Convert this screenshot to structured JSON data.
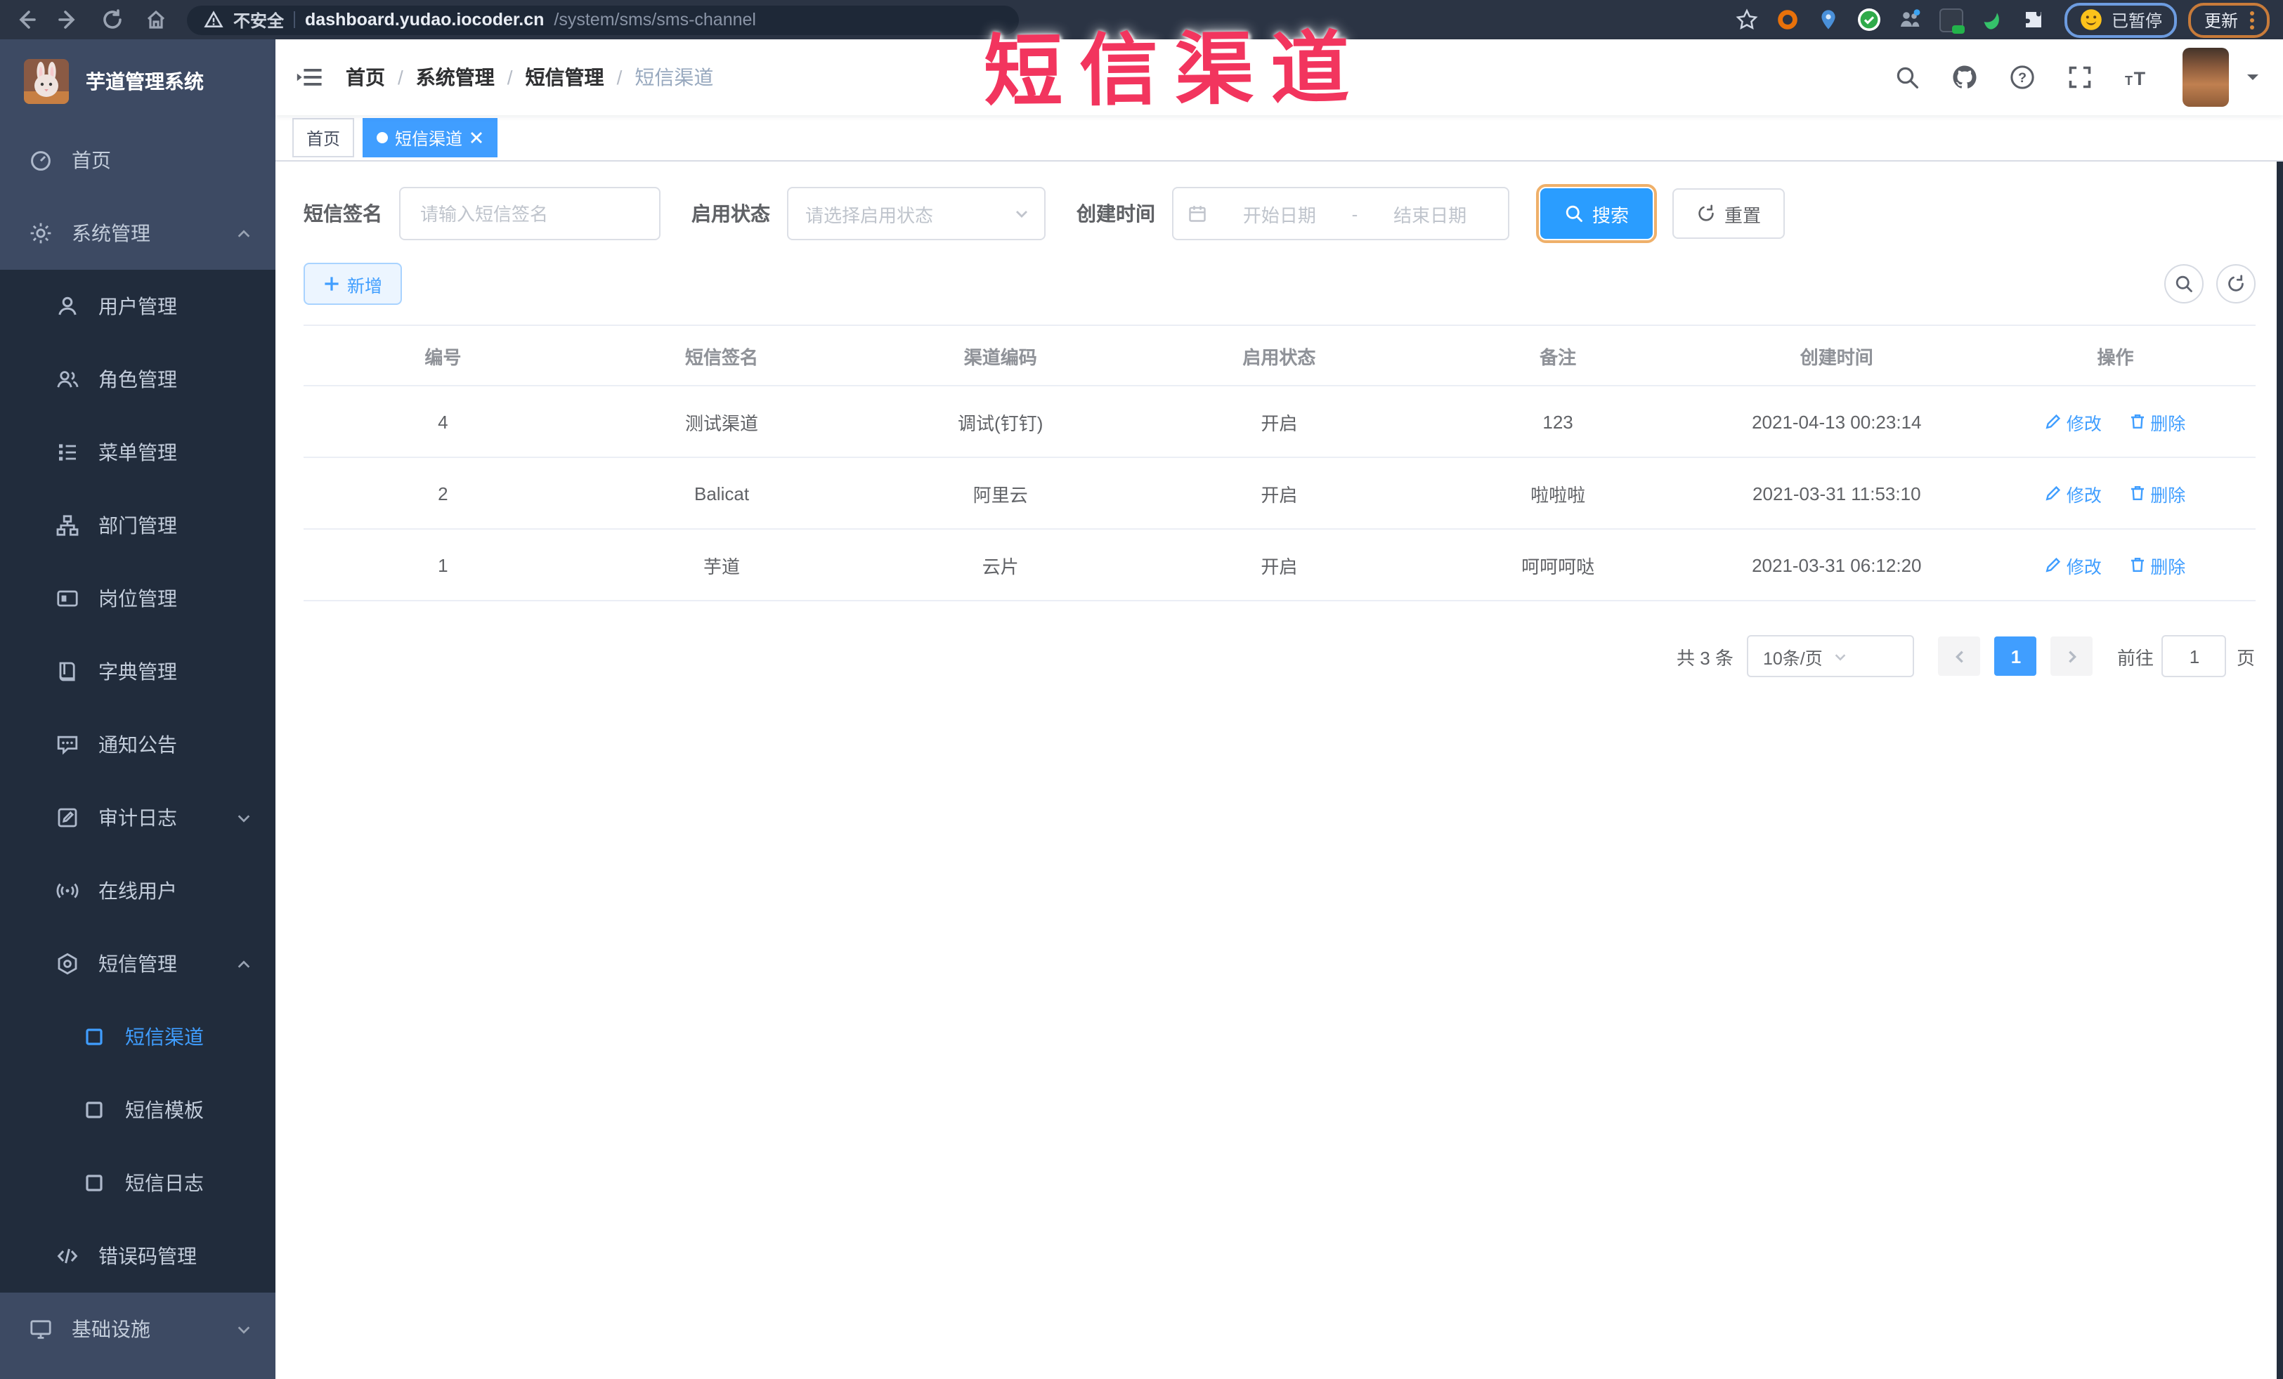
{
  "browser": {
    "security": "不安全",
    "host": "dashboard.yudao.iocoder.cn",
    "path": "/system/sms/sms-channel",
    "paused": "已暂停",
    "update": "更新"
  },
  "annotation": {
    "title": "短信渠道"
  },
  "sidebar": {
    "title": "芋道管理系统",
    "items": [
      {
        "label": "首页"
      },
      {
        "label": "系统管理"
      },
      {
        "label": "用户管理"
      },
      {
        "label": "角色管理"
      },
      {
        "label": "菜单管理"
      },
      {
        "label": "部门管理"
      },
      {
        "label": "岗位管理"
      },
      {
        "label": "字典管理"
      },
      {
        "label": "通知公告"
      },
      {
        "label": "审计日志"
      },
      {
        "label": "在线用户"
      },
      {
        "label": "短信管理"
      },
      {
        "label": "短信渠道"
      },
      {
        "label": "短信模板"
      },
      {
        "label": "短信日志"
      },
      {
        "label": "错误码管理"
      },
      {
        "label": "基础设施"
      }
    ]
  },
  "breadcrumb": {
    "separator": "/",
    "items": [
      {
        "label": "首页"
      },
      {
        "label": "系统管理"
      },
      {
        "label": "短信管理"
      },
      {
        "label": "短信渠道"
      }
    ]
  },
  "tabs": [
    {
      "label": "首页"
    },
    {
      "label": "短信渠道"
    }
  ],
  "filters": {
    "signature_label": "短信签名",
    "signature_placeholder": "请输入短信签名",
    "status_label": "启用状态",
    "status_placeholder": "请选择启用状态",
    "created_label": "创建时间",
    "date_start": "开始日期",
    "date_sep": "-",
    "date_end": "结束日期",
    "search": "搜索",
    "reset": "重置"
  },
  "toolbar": {
    "add": "新增"
  },
  "table": {
    "columns": [
      "编号",
      "短信签名",
      "渠道编码",
      "启用状态",
      "备注",
      "创建时间",
      "操作"
    ],
    "edit": "修改",
    "delete": "删除",
    "rows": [
      {
        "id": "4",
        "signature": "测试渠道",
        "code": "调试(钉钉)",
        "status": "开启",
        "remark": "123",
        "created": "2021-04-13 00:23:14"
      },
      {
        "id": "2",
        "signature": "Balicat",
        "code": "阿里云",
        "status": "开启",
        "remark": "啦啦啦",
        "created": "2021-03-31 11:53:10"
      },
      {
        "id": "1",
        "signature": "芋道",
        "code": "云片",
        "status": "开启",
        "remark": "呵呵呵哒",
        "created": "2021-03-31 06:12:20"
      }
    ]
  },
  "pagination": {
    "total": "共 3 条",
    "page_size": "10条/页",
    "page": "1",
    "jump_prefix": "前往",
    "jump_value": "1",
    "jump_suffix": "页"
  },
  "colors": {
    "accent": "#409eff",
    "annotation": "#f2355e",
    "sidebar": "#3d4a63",
    "submenu": "#212c3c"
  }
}
